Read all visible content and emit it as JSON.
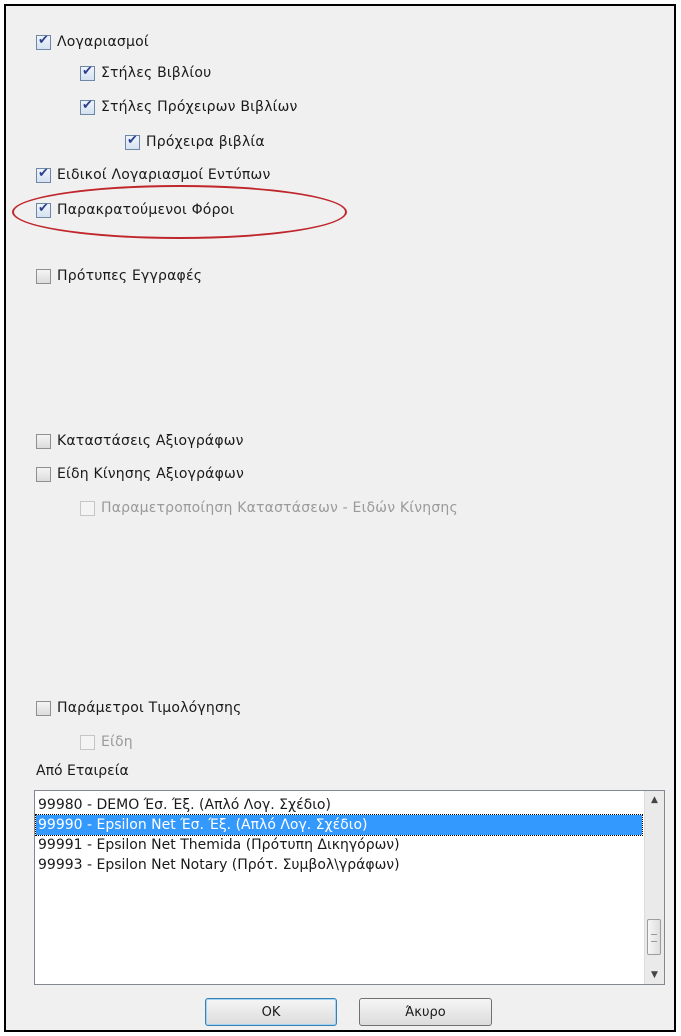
{
  "options": [
    {
      "label": "Λογαριασμοί",
      "checked": true,
      "disabled": false
    },
    {
      "label": "Στήλες Βιβλίου",
      "checked": true,
      "disabled": false
    },
    {
      "label": "Στήλες Πρόχειρων Βιβλίων",
      "checked": true,
      "disabled": false
    },
    {
      "label": "Πρόχειρα βιβλία",
      "checked": true,
      "disabled": false
    },
    {
      "label": "Ειδικοί Λογαριασμοί Εντύπων",
      "checked": true,
      "disabled": false
    },
    {
      "label": "Παρακρατούμενοι Φόροι",
      "checked": true,
      "disabled": false
    },
    {
      "label": "Πρότυπες Εγγραφές",
      "checked": false,
      "disabled": false
    },
    {
      "label": "Καταστάσεις Αξιογράφων",
      "checked": false,
      "disabled": false
    },
    {
      "label": "Είδη Κίνησης Αξιογράφων",
      "checked": false,
      "disabled": false
    },
    {
      "label": "Παραμετροποίηση Καταστάσεων - Ειδών Κίνησης",
      "checked": false,
      "disabled": true
    },
    {
      "label": "Παράμετροι Τιμολόγησης",
      "checked": false,
      "disabled": false
    },
    {
      "label": "Είδη",
      "checked": false,
      "disabled": true
    }
  ],
  "company_label": "Από Εταιρεία",
  "companies": [
    {
      "label": "99980 - DEMO Έσ. Έξ. (Απλό Λογ. Σχέδιο)",
      "selected": false
    },
    {
      "label": "99990 - Epsilon Net Έσ. Έξ. (Απλό Λογ. Σχέδιο)",
      "selected": true
    },
    {
      "label": "99991 - Epsilon Net Themida (Πρότυπη Δικηγόρων)",
      "selected": false
    },
    {
      "label": "99993 - Epsilon Net Notary (Πρότ. Συμβολ\\γράφων)",
      "selected": false
    }
  ],
  "buttons": {
    "ok": "OK",
    "cancel": "Άκυρο"
  },
  "colors": {
    "highlight_ellipse": "#c0272d",
    "selection": "#3399ff"
  },
  "icons": {
    "checkbox": "checkbox-icon",
    "scroll_up": "scroll-up-icon",
    "scroll_down": "scroll-down-icon"
  }
}
